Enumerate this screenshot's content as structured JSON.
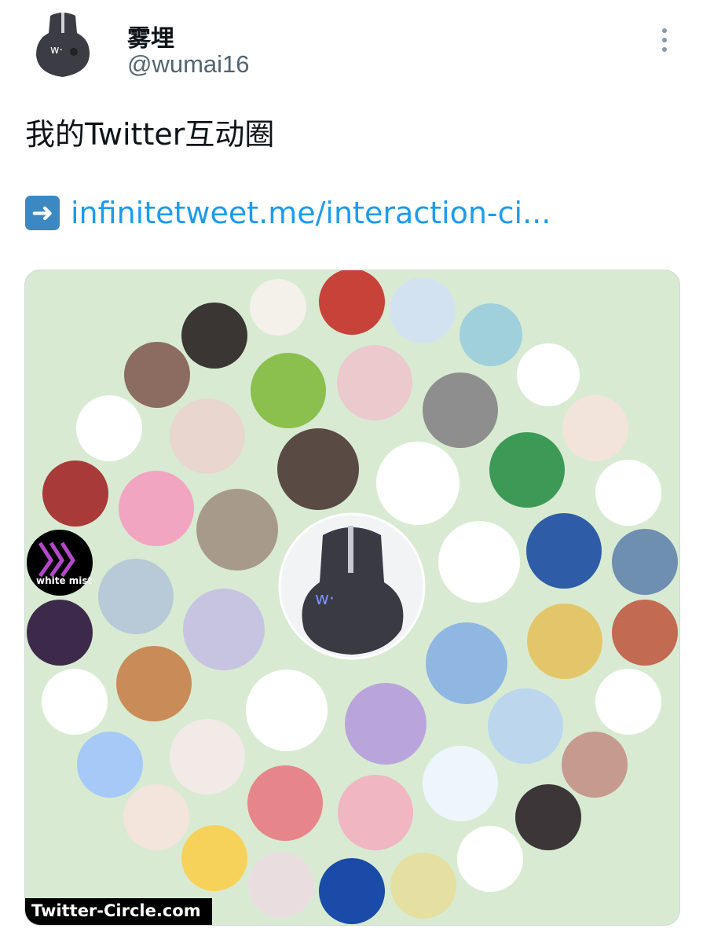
{
  "tweet": {
    "display_name": "雾埋",
    "handle": "@wumai16",
    "text": "我的Twitter互动圈",
    "link_emoji": "arrow-right-icon",
    "link_text": "infinitetweet.me/interaction-ci..."
  },
  "card": {
    "watermark": "Twitter-Circle.com",
    "background": "#d8ebd2",
    "center_avatar_text": "w·",
    "circle_texts": {
      "white_mist": "white mist"
    }
  }
}
